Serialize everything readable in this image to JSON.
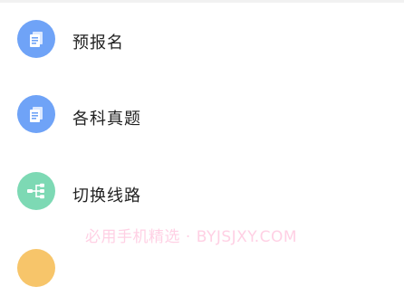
{
  "menu": {
    "items": [
      {
        "label": "预报名",
        "icon": "document-icon",
        "color": "#6fa3f7"
      },
      {
        "label": "各科真题",
        "icon": "document-icon",
        "color": "#6fa3f7"
      },
      {
        "label": "切换线路",
        "icon": "route-switch-icon",
        "color": "#7dd9b4"
      },
      {
        "label": "",
        "icon": "item-icon",
        "color": "#f7c56a"
      }
    ]
  },
  "watermark": "必用手机精选 · BYJSJXY.COM"
}
